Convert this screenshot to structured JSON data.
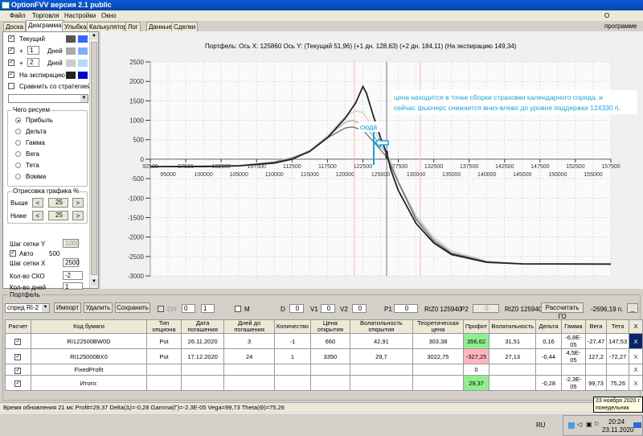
{
  "window": {
    "title": "OptionFVV версия 2.1 public"
  },
  "menu": {
    "items": [
      "Файл",
      "Торговля",
      "Настройки",
      "Окно"
    ],
    "about": "О программе"
  },
  "tabs": [
    {
      "label": "Доска"
    },
    {
      "label": "Диаграмма",
      "active": true
    },
    {
      "label": "Улыбка"
    },
    {
      "label": "Калькулятор"
    },
    {
      "label": "Лог"
    },
    {
      "label": "Данные"
    },
    {
      "label": "Сделки"
    }
  ],
  "left": {
    "current": {
      "label": "Текущий",
      "checked": true,
      "colors": [
        "#555555",
        "#3366ff"
      ]
    },
    "plus1": {
      "prefix": "+",
      "value": "1",
      "label": "Дней",
      "checked": true,
      "colors": [
        "#aaaaaa",
        "#7fb0ff"
      ]
    },
    "plus2": {
      "prefix": "+",
      "value": "2",
      "label": "Дней",
      "checked": true,
      "colors": [
        "#cccccc",
        "#b0dcff"
      ]
    },
    "expiry": {
      "label": "На экспирацию",
      "checked": true,
      "colors": [
        "#222222",
        "#0000cc"
      ]
    },
    "compare": {
      "label": "Сравнить со стратегией",
      "checked": false
    },
    "draw_group": {
      "title": "Чего рисуем",
      "options": [
        "Прибыль",
        "Дельта",
        "Гамма",
        "Вега",
        "Тета",
        "Вомма"
      ],
      "selected": "Прибыль"
    },
    "range_group": {
      "title": "Отрисовка графика %",
      "above_label": "Выше",
      "above": "25",
      "below_label": "Ниже",
      "below": "25",
      "prev": "<",
      "next": ">"
    },
    "grid_y_label": "Шаг сетки Y",
    "grid_y": "1000",
    "auto_label": "Авто",
    "auto_checked": true,
    "auto_value": "500",
    "grid_x_label": "Шаг сетки X",
    "grid_x": "2500",
    "sko_label": "Кол-во СКО",
    "sko": "-2",
    "days_label": "Кол-во дней",
    "days": "1"
  },
  "chart": {
    "header": "Портфель: Ось X: 125860 Ось Y:  (Текущий 51,96)  (+1 дн. 128,63)  (+2 дн. 184,11)  (На экспирацию 149,34)",
    "annotation": [
      "цена находится в точке сборки страховки календарного спреда, и",
      "сейчас фьючерс снижается вниз-влево до уровня поддержки  124330 п."
    ],
    "arrow_label": "сюда",
    "accent": "#1aa3d9"
  },
  "chart_data": {
    "type": "line",
    "xlim": [
      92500,
      157500
    ],
    "ylim": [
      -3000,
      2500
    ],
    "yticks": [
      2500,
      2000,
      1500,
      1000,
      500,
      0,
      -500,
      -1000,
      -1500,
      -2000,
      -2500,
      -3000
    ],
    "xticks_top": [
      92500,
      97500,
      102500,
      107500,
      112500,
      117500,
      122500,
      127500,
      132500,
      137500,
      142500,
      147500,
      152500,
      157500
    ],
    "xticks_bottom": [
      95000,
      100000,
      105000,
      110000,
      115000,
      120000,
      125000,
      130000,
      135000,
      140000,
      145000,
      150000,
      155000
    ],
    "grid": true,
    "current_price": 125860,
    "sigma_lines": [
      121300,
      130600
    ],
    "series": [
      {
        "name": "+2 дн.",
        "color": "#cccccc",
        "points": [
          [
            92500,
            -190
          ],
          [
            105000,
            -160
          ],
          [
            110000,
            -60
          ],
          [
            112500,
            50
          ],
          [
            115000,
            230
          ],
          [
            117500,
            600
          ],
          [
            120000,
            1100
          ],
          [
            121500,
            1240
          ],
          [
            122500,
            1200
          ],
          [
            124000,
            800
          ],
          [
            125000,
            450
          ],
          [
            125860,
            184
          ],
          [
            127500,
            -550
          ],
          [
            130000,
            -1450
          ],
          [
            132500,
            -2000
          ],
          [
            135000,
            -2350
          ],
          [
            140000,
            -2620
          ],
          [
            145000,
            -2685
          ],
          [
            157500,
            -2696
          ]
        ]
      },
      {
        "name": "+1 дн.",
        "color": "#aaaaaa",
        "points": [
          [
            92500,
            -190
          ],
          [
            105000,
            -165
          ],
          [
            110000,
            -70
          ],
          [
            112500,
            30
          ],
          [
            115000,
            210
          ],
          [
            117500,
            580
          ],
          [
            120000,
            950
          ],
          [
            121000,
            1000
          ],
          [
            122500,
            900
          ],
          [
            124000,
            600
          ],
          [
            125860,
            129
          ],
          [
            127500,
            -580
          ],
          [
            130000,
            -1500
          ],
          [
            132500,
            -2050
          ],
          [
            135000,
            -2400
          ],
          [
            140000,
            -2630
          ],
          [
            145000,
            -2690
          ],
          [
            157500,
            -2696
          ]
        ]
      },
      {
        "name": "Текущий",
        "color": "#666666",
        "points": [
          [
            92500,
            -190
          ],
          [
            105000,
            -170
          ],
          [
            110000,
            -80
          ],
          [
            112500,
            20
          ],
          [
            115000,
            200
          ],
          [
            117500,
            550
          ],
          [
            120000,
            800
          ],
          [
            121000,
            830
          ],
          [
            122500,
            750
          ],
          [
            124000,
            450
          ],
          [
            125860,
            52
          ],
          [
            127500,
            -600
          ],
          [
            130000,
            -1550
          ],
          [
            132500,
            -2100
          ],
          [
            135000,
            -2420
          ],
          [
            140000,
            -2640
          ],
          [
            145000,
            -2692
          ],
          [
            157500,
            -2696
          ]
        ]
      },
      {
        "name": "На экспирацию",
        "color": "#222222",
        "points": [
          [
            92500,
            -190
          ],
          [
            100000,
            -190
          ],
          [
            105000,
            -170
          ],
          [
            110000,
            -100
          ],
          [
            112500,
            0
          ],
          [
            115000,
            200
          ],
          [
            117500,
            550
          ],
          [
            120000,
            1050
          ],
          [
            121500,
            1450
          ],
          [
            122500,
            1870
          ],
          [
            123000,
            1700
          ],
          [
            124000,
            1100
          ],
          [
            125000,
            550
          ],
          [
            125860,
            149
          ],
          [
            126500,
            -300
          ],
          [
            127500,
            -800
          ],
          [
            130000,
            -1650
          ],
          [
            132500,
            -2150
          ],
          [
            135000,
            -2450
          ],
          [
            140000,
            -2650
          ],
          [
            145000,
            -2690
          ],
          [
            157500,
            -2696
          ]
        ]
      }
    ]
  },
  "portfolio": {
    "title": "Портфель",
    "selector": "спред RI-2",
    "import": "Импорт",
    "delete": "Удалить",
    "save": "Сохранить",
    "dh_label": "DH",
    "dh1": "0",
    "dh2": "1",
    "m_label": "M",
    "d_label": "D",
    "d": "0",
    "v1_label": "V1",
    "v1": "0",
    "v2_label": "V2",
    "v2": "0",
    "p1_label": "P1",
    "p1": "0",
    "p1_ref": "RIZ0 125940",
    "p2_label": "P2",
    "p2": "0",
    "p2_ref": "RIZ0 125940",
    "calc_go": "Рассчитать ГО",
    "go_value": "-2696,19 п.",
    "minimize": "_",
    "columns": [
      "Расчет",
      "Код бумаги",
      "Тип опциона",
      "Дата погашения",
      "Дней до погашения",
      "Количество",
      "Цена открытия",
      "Волатильность открытия",
      "Теоретическая цена",
      "Профит",
      "Волатильность",
      "Дельта",
      "Гамма",
      "Вега",
      "Тета",
      "X"
    ],
    "rows": [
      {
        "calc": true,
        "code": "RI122500BW0D",
        "type": "Put",
        "date": "26.11.2020",
        "days": "3",
        "qty": "-1",
        "price": "660",
        "vol_open": "42,91",
        "theor": "303,38",
        "profit": "356,62",
        "profit_color": "#90ee90",
        "vol": "31,51",
        "delta": "0,16",
        "gamma": "-6,8E-05",
        "vega": "-27,47",
        "theta": "147,53",
        "x": "X",
        "x_selected": true
      },
      {
        "calc": true,
        "code": "RI125000BX0",
        "type": "Put",
        "date": "17.12.2020",
        "days": "24",
        "qty": "1",
        "price": "3350",
        "vol_open": "29,7",
        "theor": "3022,75",
        "profit": "-327,25",
        "profit_color": "#ffb6c1",
        "vol": "27,13",
        "delta": "-0,44",
        "gamma": "4,5E-05",
        "vega": "127,2",
        "theta": "-72,27",
        "x": "X"
      },
      {
        "calc": true,
        "code": "FixedProfit",
        "type": "",
        "date": "",
        "days": "",
        "qty": "",
        "price": "",
        "vol_open": "",
        "theor": "",
        "profit": "0",
        "profit_color": "",
        "vol": "",
        "delta": "",
        "gamma": "",
        "vega": "",
        "theta": "",
        "x": "X"
      },
      {
        "calc": true,
        "code": "Итого:",
        "type": "",
        "date": "",
        "days": "",
        "qty": "",
        "price": "",
        "vol_open": "",
        "theor": "",
        "profit": "29,37",
        "profit_color": "#90ee90",
        "vol": "",
        "delta": "-0,28",
        "gamma": "-2,3E-05",
        "vega": "99,73",
        "theta": "75,26",
        "x": "X"
      }
    ]
  },
  "status": "Время обновления 21 мс  Profit=29,37 Delta(Δ)=-0,28 Gamma(Γ)=-2,3E-05 Vega=99,73 Theta(Θ)=75,26",
  "taskbar": {
    "lang": "RU",
    "time": "20:24",
    "date": "23.11.2020",
    "tooltip": [
      "23 ноября 2020 г.",
      "понедельник"
    ]
  }
}
